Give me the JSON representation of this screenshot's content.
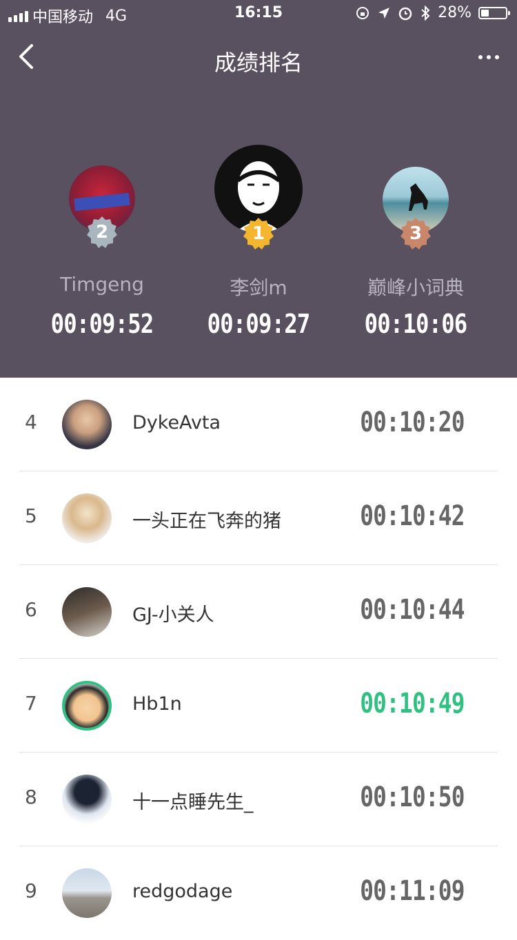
{
  "status_bar": {
    "carrier": "中国移动",
    "network": "4G",
    "time": "16:15",
    "battery": "28%",
    "battery_level": 0.28
  },
  "nav": {
    "title": "成绩排名"
  },
  "podium": [
    {
      "rank": "1",
      "name": "李剑m",
      "time": "00:09:27",
      "medal_color": "#f4b62e",
      "avatar_icon": "cartoon-man-avatar"
    },
    {
      "rank": "2",
      "name": "Timgeng",
      "time": "00:09:52",
      "medal_color": "#a9b6be",
      "avatar_icon": "fireworks-text-avatar"
    },
    {
      "rank": "3",
      "name": "巅峰小词典",
      "time": "00:10:06",
      "medal_color": "#c8876a",
      "avatar_icon": "horse-beach-avatar"
    }
  ],
  "list": [
    {
      "rank": "4",
      "name": "DykeAvta",
      "time": "00:10:20"
    },
    {
      "rank": "5",
      "name": "一头正在飞奔的猪",
      "time": "00:10:42"
    },
    {
      "rank": "6",
      "name": "GJ-小关人",
      "time": "00:10:44"
    },
    {
      "rank": "7",
      "name": "Hb1n",
      "time": "00:10:49",
      "current_user": true
    },
    {
      "rank": "8",
      "name": "十一点睡先生_",
      "time": "00:10:50"
    },
    {
      "rank": "9",
      "name": "redgodage",
      "time": "00:11:09"
    }
  ],
  "colors": {
    "header_bg": "#5a5160",
    "highlight": "#2fc082",
    "time_gray": "#666666"
  }
}
